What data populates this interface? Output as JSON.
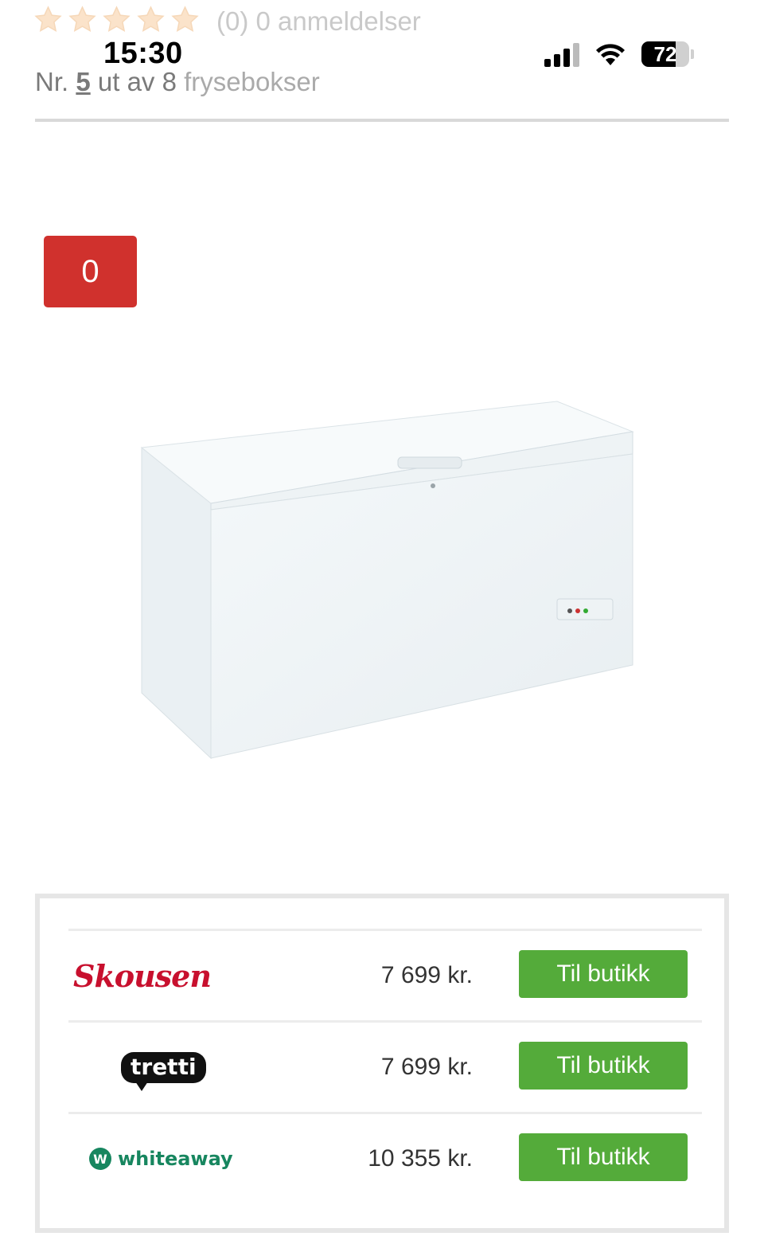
{
  "rating": {
    "stars": 0,
    "max_stars": 5,
    "count_text": "(0) 0 anmeldelser"
  },
  "status_bar": {
    "time": "15:30",
    "battery": "72"
  },
  "rank": {
    "prefix": "Nr.",
    "position": "5",
    "middle": "ut av 8",
    "category": "frysebokser"
  },
  "badge": {
    "value": "0",
    "color": "#d0312d"
  },
  "offers": [
    {
      "store": "Skousen",
      "logo_icon": "skousen-logo",
      "price": "7 699 kr.",
      "button": "Til butikk"
    },
    {
      "store": "tretti",
      "logo_icon": "tretti-logo",
      "price": "7 699 kr.",
      "button": "Til butikk"
    },
    {
      "store": "whiteaway",
      "logo_icon": "whiteaway-logo",
      "price": "10 355 kr.",
      "button": "Til butikk"
    }
  ],
  "colors": {
    "button": "#54ab3a",
    "badge": "#d0312d"
  }
}
